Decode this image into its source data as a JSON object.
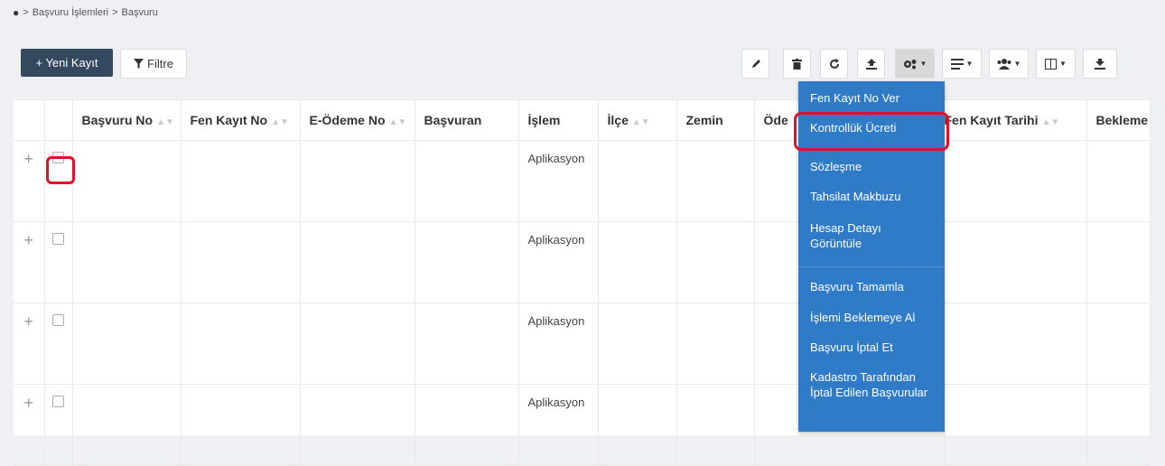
{
  "breadcrumb": {
    "home_icon": "dashboard-icon",
    "sep1": ">",
    "item1": "Başvuru İşlemleri",
    "sep2": ">",
    "item2": "Başvuru"
  },
  "toolbar": {
    "new_label": "+ Yeni Kayıt",
    "filter_label": "Filtre",
    "filter_icon": "filter-icon",
    "icons": [
      "edit-icon",
      "delete-icon",
      "refresh-icon",
      "upload-icon",
      "actions-cog-icon",
      "list-icon",
      "users-icon",
      "columns-icon",
      "download-icon"
    ]
  },
  "table": {
    "columns": [
      {
        "label": "Başvuru No",
        "sortable": true
      },
      {
        "label": "Fen Kayıt No",
        "sortable": true
      },
      {
        "label": "E-Ödeme No",
        "sortable": true
      },
      {
        "label": "Başvuran",
        "sortable": false
      },
      {
        "label": "İşlem",
        "sortable": false
      },
      {
        "label": "İlçe",
        "sortable": true
      },
      {
        "label": "Zemin",
        "sortable": false
      },
      {
        "label": "Öde",
        "sortable": false
      },
      {
        "label": "Fen Kayıt Tarihi",
        "sortable": true
      },
      {
        "label": "Bekleme",
        "sortable": false
      }
    ],
    "rows": [
      {
        "expand": "+",
        "islem": "Aplikasyon"
      },
      {
        "expand": "+",
        "islem": "Aplikasyon"
      },
      {
        "expand": "+",
        "islem": "Aplikasyon"
      },
      {
        "expand": "+",
        "islem": "Aplikasyon"
      }
    ]
  },
  "dropdown": {
    "items": [
      "Fen Kayıt No Ver",
      "Kontrollük Ücreti",
      "Sözleşme",
      "Tahsilat Makbuzu",
      "Hesap Detayı Görüntüle",
      "Başvuru Tamamla",
      "İşlemi Beklemeye Al",
      "Başvuru İptal Et",
      "Kadastro Tarafından İptal Edilen Başvurular"
    ]
  },
  "colors": {
    "primary_button": "#34495e",
    "dropdown_bg": "#2f7bc8",
    "highlight": "#e0102a"
  }
}
